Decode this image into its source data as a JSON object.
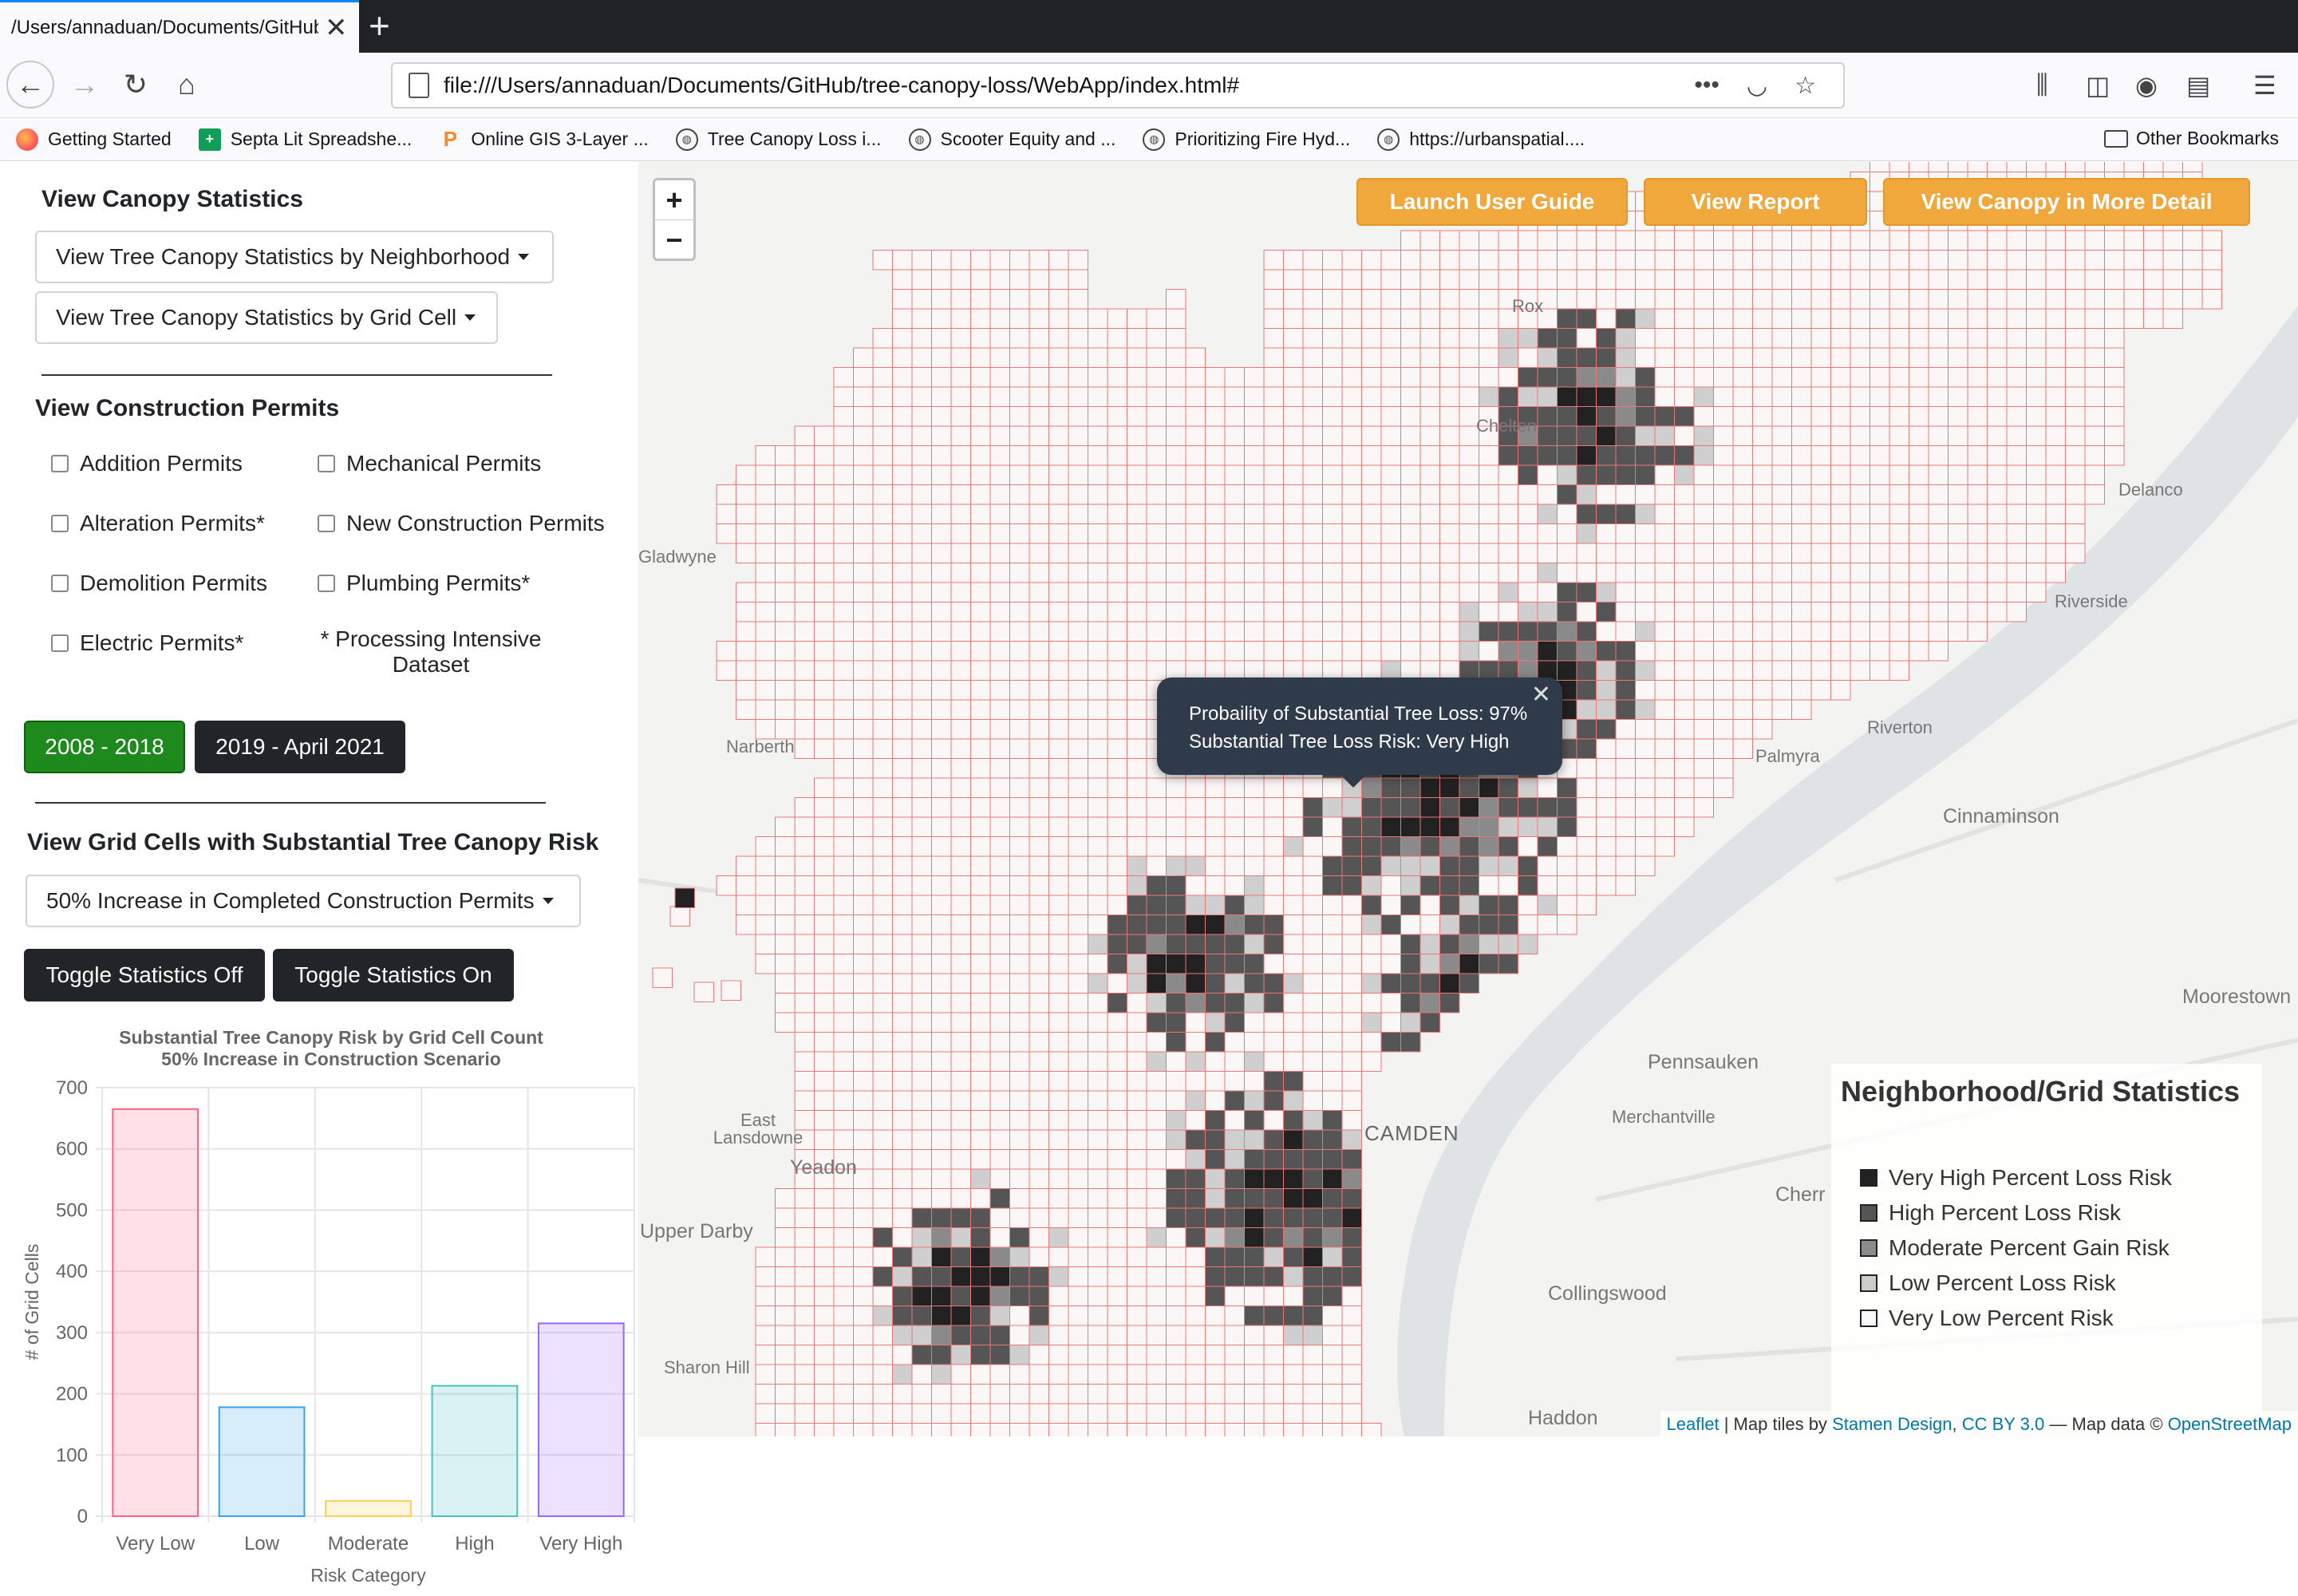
{
  "browser": {
    "tab_title": "/Users/annaduan/Documents/GitHub/tree-canopy-loss/WebApp/index.html#",
    "url": "file:///Users/annaduan/Documents/GitHub/tree-canopy-loss/WebApp/index.html#",
    "bookmarks": [
      {
        "label": "Getting Started",
        "icon": "firefox-icon"
      },
      {
        "label": "Septa Lit Spreadshe...",
        "icon": "sheets-icon"
      },
      {
        "label": "Online GIS 3-Layer ...",
        "icon": "p-icon"
      },
      {
        "label": "Tree Canopy Loss i...",
        "icon": "globe-icon"
      },
      {
        "label": "Scooter Equity and ...",
        "icon": "globe-icon"
      },
      {
        "label": "Prioritizing Fire Hyd...",
        "icon": "globe-icon"
      },
      {
        "label": "https://urbanspatial....",
        "icon": "globe-icon"
      }
    ],
    "other_bookmarks": "Other Bookmarks"
  },
  "sidebar": {
    "canopy_heading": "View Canopy Statistics",
    "dropdown_neighborhood": "View Tree Canopy Statistics by Neighborhood",
    "dropdown_grid": "View Tree Canopy Statistics by Grid Cell",
    "permits_heading": "View Construction Permits",
    "permits": {
      "addition": "Addition Permits",
      "mechanical": "Mechanical Permits",
      "alteration": "Alteration Permits*",
      "new_construction": "New Construction Permits",
      "demolition": "Demolition Permits",
      "plumbing": "Plumbing Permits*",
      "electric": "Electric Permits*"
    },
    "note": "* Processing Intensive Dataset",
    "period_a": "2008 - 2018",
    "period_b": "2019 - April 2021",
    "risk_heading": "View Grid Cells with Substantial Tree Canopy Risk",
    "scenario_dropdown": "50% Increase in Completed Construction Permits",
    "toggle_off": "Toggle Statistics Off",
    "toggle_on": "Toggle Statistics On"
  },
  "chart_data": {
    "type": "bar",
    "title": "Substantial Tree Canopy Risk by Grid Cell Count",
    "subtitle": "50% Increase in Construction Scenario",
    "xlabel": "Risk Category",
    "ylabel": "# of Grid Cells",
    "categories": [
      "Very Low",
      "Low",
      "Moderate",
      "High",
      "Very High"
    ],
    "values": [
      665,
      178,
      25,
      213,
      315
    ],
    "ylim": [
      0,
      700
    ],
    "yticks": [
      0,
      100,
      200,
      300,
      400,
      500,
      600,
      700
    ],
    "grid": true,
    "colors": [
      "#ff6384",
      "#36a2eb",
      "#ffce56",
      "#4bc0c0",
      "#9966ff"
    ]
  },
  "map": {
    "buttons": {
      "user_guide": "Launch User Guide",
      "report": "View Report",
      "detail": "View Canopy in More Detail"
    },
    "zoom_in": "+",
    "zoom_out": "−",
    "popup": {
      "line1": "Probaility of Substantial Tree Loss: 97%",
      "line2": "Substantial Tree Loss Risk: Very High"
    },
    "legend": {
      "title": "Neighborhood/Grid Statistics",
      "items": [
        {
          "label": "Very High Percent Loss Risk",
          "color": "#222222"
        },
        {
          "label": "High Percent Loss Risk",
          "color": "#555555"
        },
        {
          "label": "Moderate Percent Gain Risk",
          "color": "#8c8c8c"
        },
        {
          "label": "Low Percent Loss Risk",
          "color": "#cccccc"
        },
        {
          "label": "Very Low Percent Risk",
          "color": "#f9f9f9"
        }
      ]
    },
    "places": {
      "rox": "Rox",
      "chelten": "Chelten",
      "delanco": "Delanco",
      "gladwyne": "Gladwyne",
      "riverside": "Riverside",
      "narberth": "Narberth",
      "riverton": "Riverton",
      "palmyra": "Palmyra",
      "cinnaminson": "Cinnaminson",
      "moorestown": "Moorestown",
      "pennsauken": "Pennsauken",
      "merchantville": "Merchantville",
      "east_lansdowne": "East Lansdowne",
      "yeadon": "Yeadon",
      "camden": "CAMDEN",
      "cherr": "Cherr",
      "upper_darby": "Upper Darby",
      "collingswood": "Collingswood",
      "sharon_hill": "Sharon Hill",
      "haddon": "Haddon"
    },
    "attribution": {
      "leaflet": "Leaflet",
      "tiles_by": "| Map tiles by",
      "stamen": "Stamen Design",
      "cc": "CC BY 3.0",
      "data": "— Map data ©",
      "osm": "OpenStreetMap"
    }
  }
}
